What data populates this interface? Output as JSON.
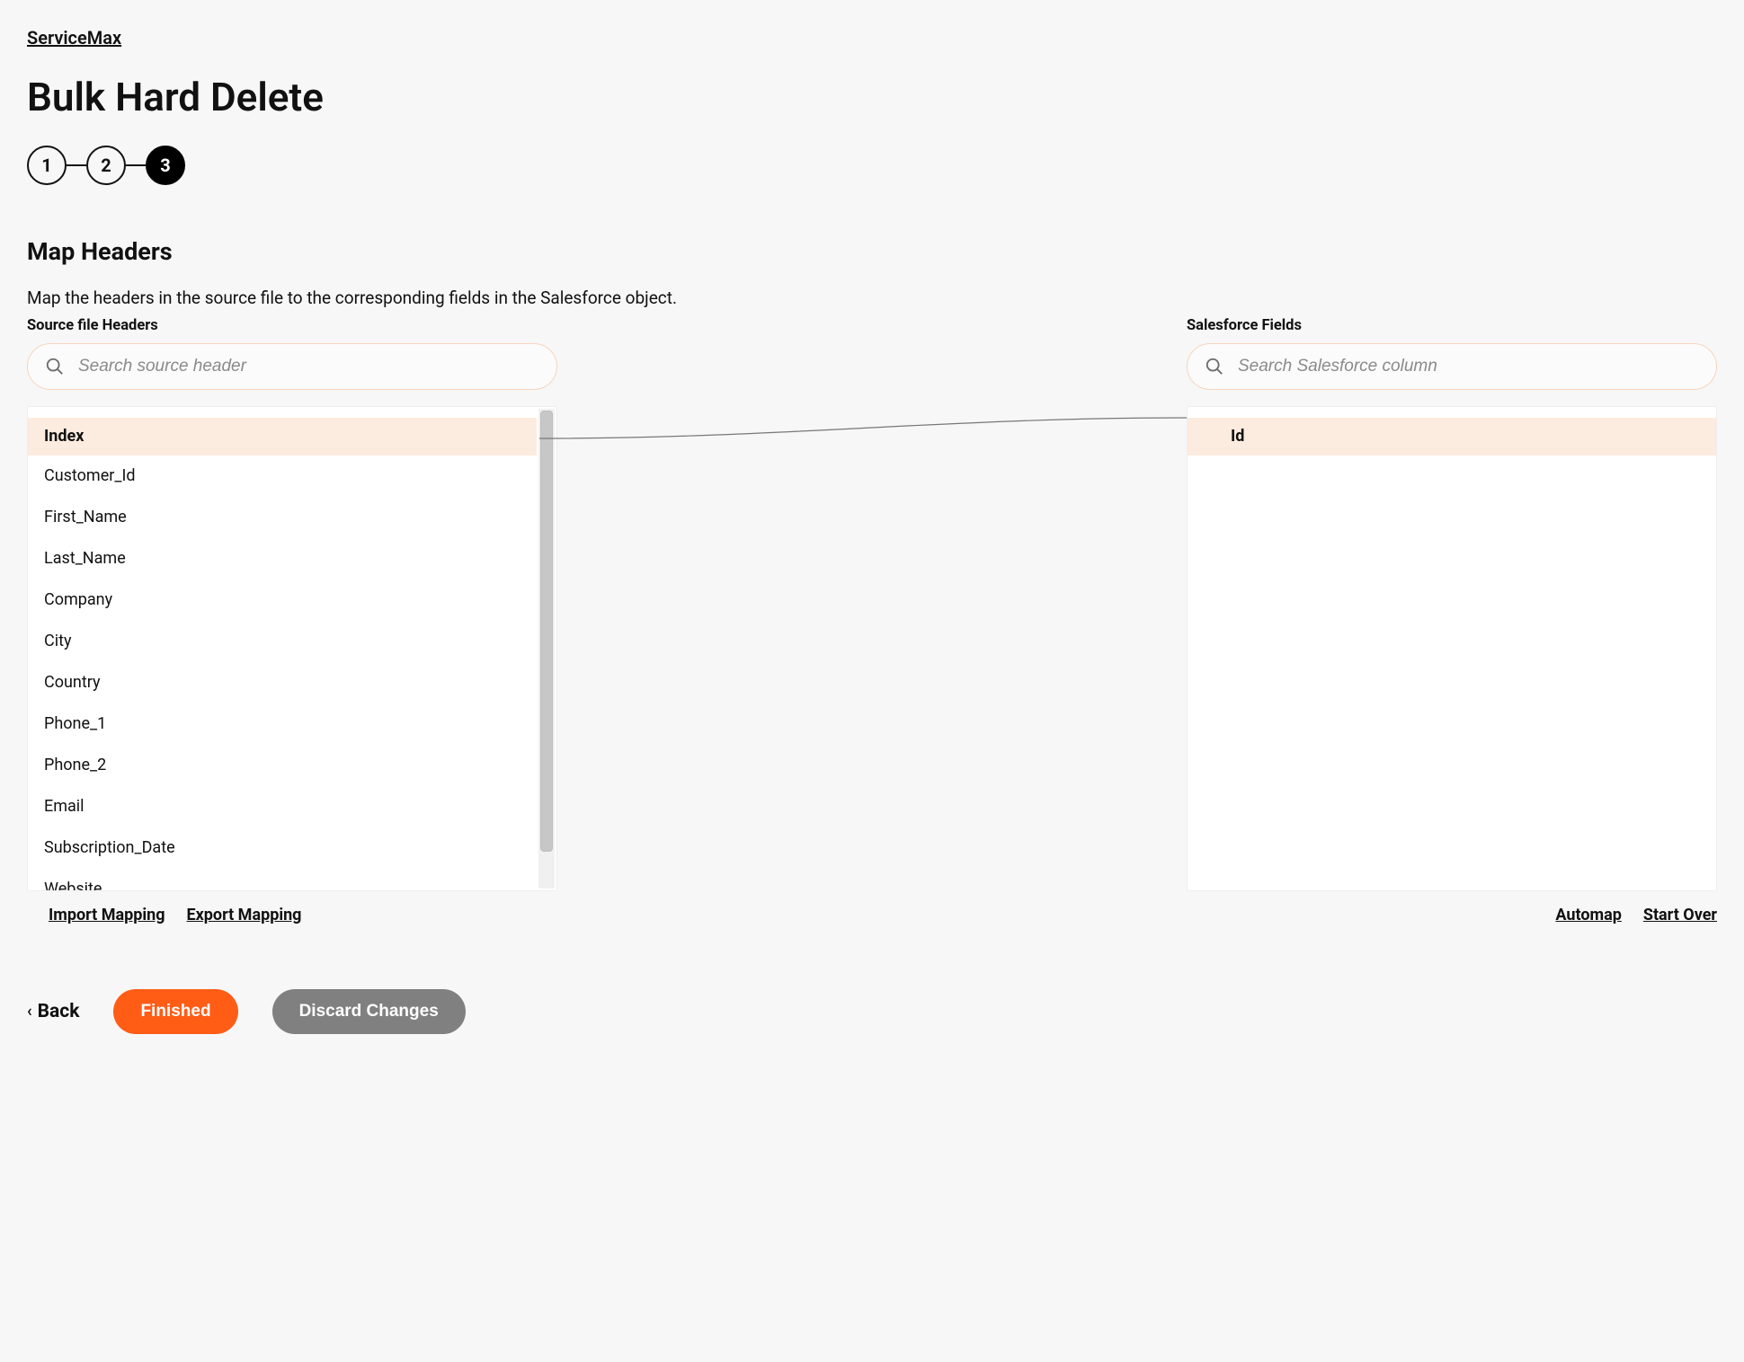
{
  "breadcrumb": {
    "label": "ServiceMax"
  },
  "page_title": "Bulk Hard Delete",
  "stepper": {
    "steps": [
      "1",
      "2",
      "3"
    ],
    "active_index": 2
  },
  "section": {
    "title": "Map Headers",
    "description": "Map the headers in the source file to the corresponding fields in the Salesforce object."
  },
  "source_column": {
    "label": "Source file Headers",
    "search_placeholder": "Search source header",
    "items": [
      {
        "label": "Index",
        "selected": true
      },
      {
        "label": "Customer_Id",
        "selected": false
      },
      {
        "label": "First_Name",
        "selected": false
      },
      {
        "label": "Last_Name",
        "selected": false
      },
      {
        "label": "Company",
        "selected": false
      },
      {
        "label": "City",
        "selected": false
      },
      {
        "label": "Country",
        "selected": false
      },
      {
        "label": "Phone_1",
        "selected": false
      },
      {
        "label": "Phone_2",
        "selected": false
      },
      {
        "label": "Email",
        "selected": false
      },
      {
        "label": "Subscription_Date",
        "selected": false
      },
      {
        "label": "Website",
        "selected": false
      }
    ]
  },
  "target_column": {
    "label": "Salesforce Fields",
    "search_placeholder": "Search Salesforce column",
    "items": [
      {
        "label": "Id",
        "selected": true
      }
    ]
  },
  "bottom_links": {
    "left": [
      {
        "key": "import",
        "label": "Import Mapping"
      },
      {
        "key": "export",
        "label": "Export Mapping"
      }
    ],
    "right": [
      {
        "key": "automap",
        "label": "Automap"
      },
      {
        "key": "startover",
        "label": "Start Over"
      }
    ]
  },
  "footer": {
    "back": "Back",
    "finished": "Finished",
    "discard": "Discard Changes"
  }
}
